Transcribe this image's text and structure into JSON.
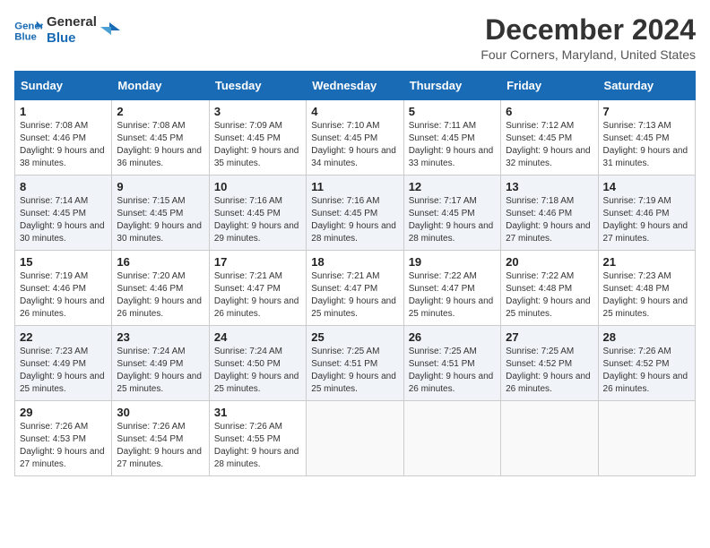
{
  "logo": {
    "line1": "General",
    "line2": "Blue"
  },
  "title": "December 2024",
  "location": "Four Corners, Maryland, United States",
  "days_of_week": [
    "Sunday",
    "Monday",
    "Tuesday",
    "Wednesday",
    "Thursday",
    "Friday",
    "Saturday"
  ],
  "weeks": [
    [
      {
        "day": "1",
        "sunrise": "7:08 AM",
        "sunset": "4:46 PM",
        "daylight": "9 hours and 38 minutes."
      },
      {
        "day": "2",
        "sunrise": "7:08 AM",
        "sunset": "4:45 PM",
        "daylight": "9 hours and 36 minutes."
      },
      {
        "day": "3",
        "sunrise": "7:09 AM",
        "sunset": "4:45 PM",
        "daylight": "9 hours and 35 minutes."
      },
      {
        "day": "4",
        "sunrise": "7:10 AM",
        "sunset": "4:45 PM",
        "daylight": "9 hours and 34 minutes."
      },
      {
        "day": "5",
        "sunrise": "7:11 AM",
        "sunset": "4:45 PM",
        "daylight": "9 hours and 33 minutes."
      },
      {
        "day": "6",
        "sunrise": "7:12 AM",
        "sunset": "4:45 PM",
        "daylight": "9 hours and 32 minutes."
      },
      {
        "day": "7",
        "sunrise": "7:13 AM",
        "sunset": "4:45 PM",
        "daylight": "9 hours and 31 minutes."
      }
    ],
    [
      {
        "day": "8",
        "sunrise": "7:14 AM",
        "sunset": "4:45 PM",
        "daylight": "9 hours and 30 minutes."
      },
      {
        "day": "9",
        "sunrise": "7:15 AM",
        "sunset": "4:45 PM",
        "daylight": "9 hours and 30 minutes."
      },
      {
        "day": "10",
        "sunrise": "7:16 AM",
        "sunset": "4:45 PM",
        "daylight": "9 hours and 29 minutes."
      },
      {
        "day": "11",
        "sunrise": "7:16 AM",
        "sunset": "4:45 PM",
        "daylight": "9 hours and 28 minutes."
      },
      {
        "day": "12",
        "sunrise": "7:17 AM",
        "sunset": "4:45 PM",
        "daylight": "9 hours and 28 minutes."
      },
      {
        "day": "13",
        "sunrise": "7:18 AM",
        "sunset": "4:46 PM",
        "daylight": "9 hours and 27 minutes."
      },
      {
        "day": "14",
        "sunrise": "7:19 AM",
        "sunset": "4:46 PM",
        "daylight": "9 hours and 27 minutes."
      }
    ],
    [
      {
        "day": "15",
        "sunrise": "7:19 AM",
        "sunset": "4:46 PM",
        "daylight": "9 hours and 26 minutes."
      },
      {
        "day": "16",
        "sunrise": "7:20 AM",
        "sunset": "4:46 PM",
        "daylight": "9 hours and 26 minutes."
      },
      {
        "day": "17",
        "sunrise": "7:21 AM",
        "sunset": "4:47 PM",
        "daylight": "9 hours and 26 minutes."
      },
      {
        "day": "18",
        "sunrise": "7:21 AM",
        "sunset": "4:47 PM",
        "daylight": "9 hours and 25 minutes."
      },
      {
        "day": "19",
        "sunrise": "7:22 AM",
        "sunset": "4:47 PM",
        "daylight": "9 hours and 25 minutes."
      },
      {
        "day": "20",
        "sunrise": "7:22 AM",
        "sunset": "4:48 PM",
        "daylight": "9 hours and 25 minutes."
      },
      {
        "day": "21",
        "sunrise": "7:23 AM",
        "sunset": "4:48 PM",
        "daylight": "9 hours and 25 minutes."
      }
    ],
    [
      {
        "day": "22",
        "sunrise": "7:23 AM",
        "sunset": "4:49 PM",
        "daylight": "9 hours and 25 minutes."
      },
      {
        "day": "23",
        "sunrise": "7:24 AM",
        "sunset": "4:49 PM",
        "daylight": "9 hours and 25 minutes."
      },
      {
        "day": "24",
        "sunrise": "7:24 AM",
        "sunset": "4:50 PM",
        "daylight": "9 hours and 25 minutes."
      },
      {
        "day": "25",
        "sunrise": "7:25 AM",
        "sunset": "4:51 PM",
        "daylight": "9 hours and 25 minutes."
      },
      {
        "day": "26",
        "sunrise": "7:25 AM",
        "sunset": "4:51 PM",
        "daylight": "9 hours and 26 minutes."
      },
      {
        "day": "27",
        "sunrise": "7:25 AM",
        "sunset": "4:52 PM",
        "daylight": "9 hours and 26 minutes."
      },
      {
        "day": "28",
        "sunrise": "7:26 AM",
        "sunset": "4:52 PM",
        "daylight": "9 hours and 26 minutes."
      }
    ],
    [
      {
        "day": "29",
        "sunrise": "7:26 AM",
        "sunset": "4:53 PM",
        "daylight": "9 hours and 27 minutes."
      },
      {
        "day": "30",
        "sunrise": "7:26 AM",
        "sunset": "4:54 PM",
        "daylight": "9 hours and 27 minutes."
      },
      {
        "day": "31",
        "sunrise": "7:26 AM",
        "sunset": "4:55 PM",
        "daylight": "9 hours and 28 minutes."
      },
      null,
      null,
      null,
      null
    ]
  ]
}
